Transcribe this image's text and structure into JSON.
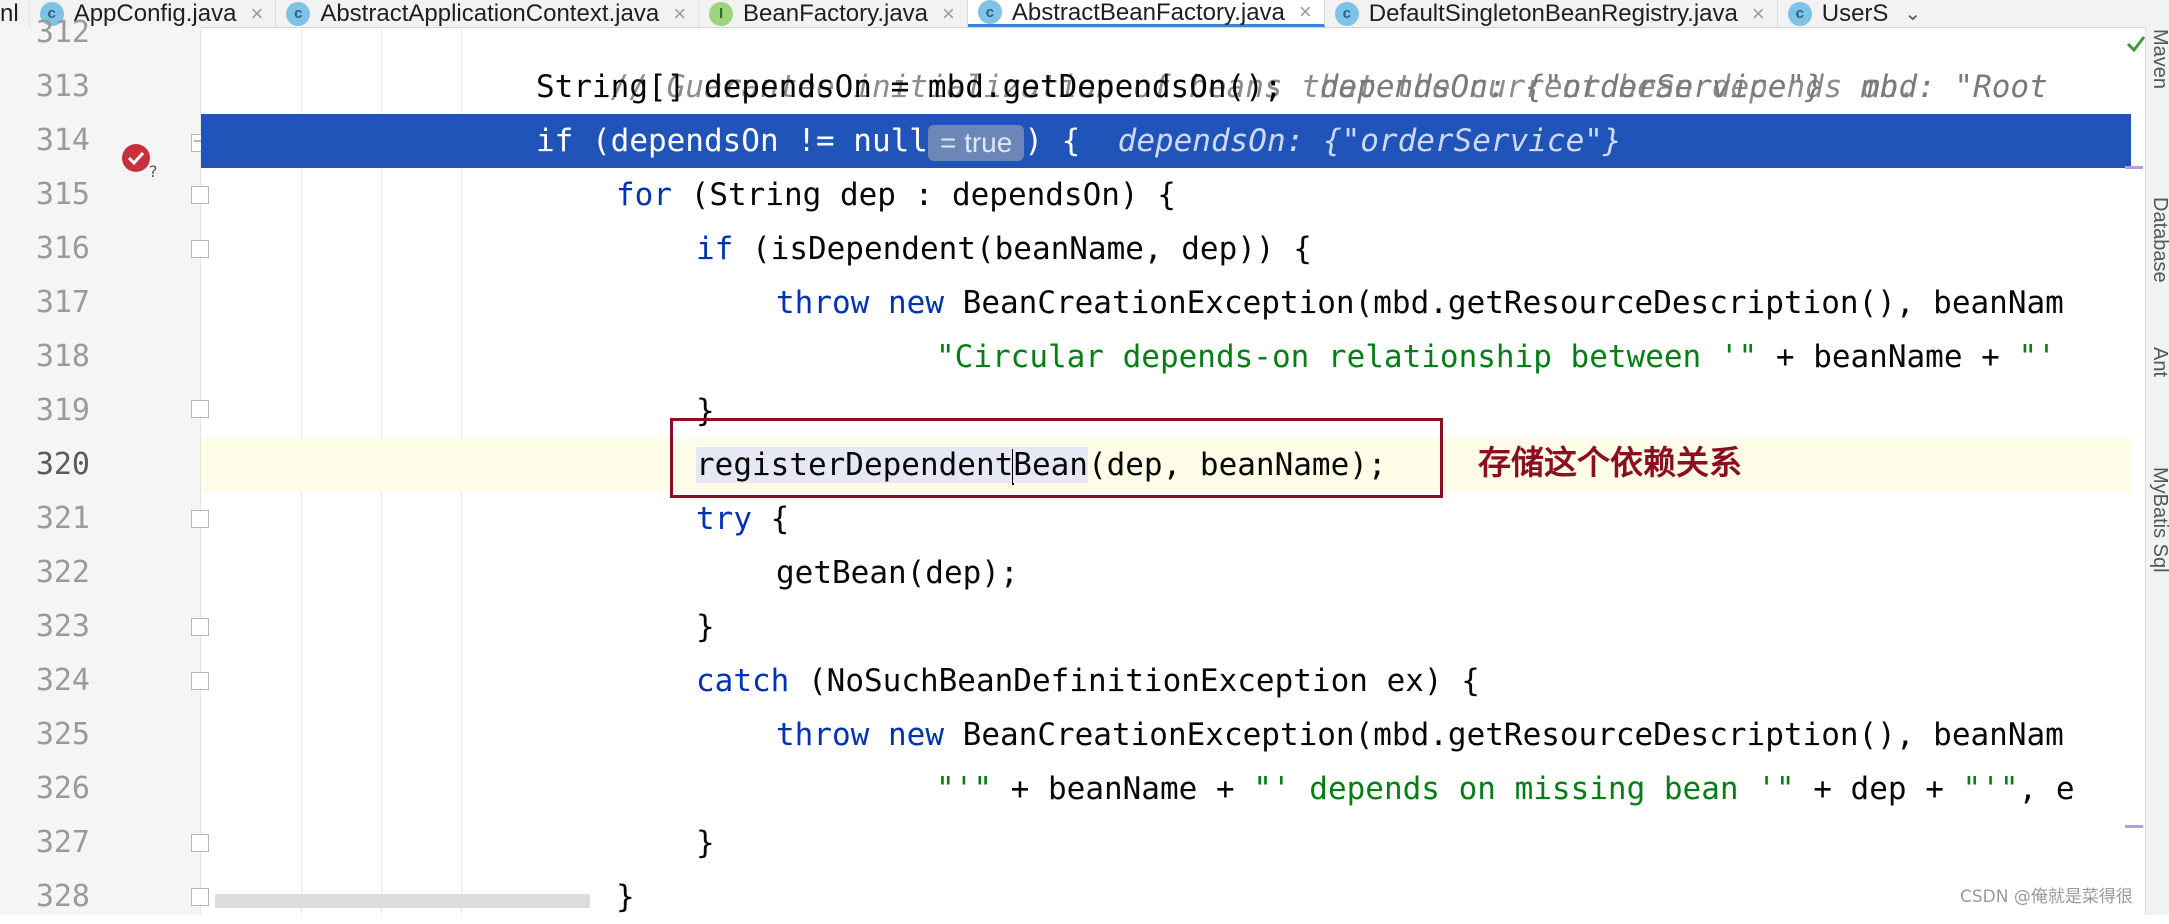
{
  "tabs": [
    {
      "label": "nl",
      "kind": "none",
      "truncated": true
    },
    {
      "label": "AppConfig.java",
      "kind": "class"
    },
    {
      "label": "AbstractApplicationContext.java",
      "kind": "class"
    },
    {
      "label": "BeanFactory.java",
      "kind": "interface"
    },
    {
      "label": "AbstractBeanFactory.java",
      "kind": "class",
      "active": true
    },
    {
      "label": "DefaultSingletonBeanRegistry.java",
      "kind": "class"
    },
    {
      "label": "UserS",
      "kind": "class",
      "truncated": true
    }
  ],
  "tab_close_glyph": "×",
  "gutter": {
    "line_numbers": [
      "312",
      "313",
      "314",
      "315",
      "316",
      "317",
      "318",
      "319",
      "320",
      "321",
      "322",
      "323",
      "324",
      "325",
      "326",
      "327",
      "328"
    ]
  },
  "code_lines": {
    "l312": "// Guarantee initialization of beans that the current bean depends on.",
    "l313_code": "String[] dependsOn = mbd.getDependsOn();",
    "l313_hint": "dependsOn: {\"orderService\"}  mbd: \"Root",
    "l314_kw": "if",
    "l314_code": " (dependsOn != null",
    "l314_inline": "= true",
    "l314_end": ") {",
    "l314_hint": "dependsOn: {\"orderService\"}",
    "l315_kw": "for",
    "l315_code": " (String dep : dependsOn) {",
    "l316_kw": "if",
    "l316_code": " (isDependent(beanName, dep)) {",
    "l317_kw1": "throw",
    "l317_kw2": "new",
    "l317_code": " BeanCreationException(mbd.getResourceDescription(), beanNam",
    "l318_str": "\"Circular depends-on relationship between '\"",
    "l318_code": " + beanName + ",
    "l318_str2": "\"'",
    "l319": "}",
    "l320_a": "registerDependent",
    "l320_b": "Bean",
    "l320_c": "(dep, beanName);",
    "l321_kw": "try",
    "l321_code": " {",
    "l322": "getBean(dep);",
    "l323": "}",
    "l324_kw": "catch",
    "l324_code": " (NoSuchBeanDefinitionException ex) {",
    "l325_kw1": "throw",
    "l325_kw2": "new",
    "l325_code": " BeanCreationException(mbd.getResourceDescription(), beanNam",
    "l326_str1": "\"'\"",
    "l326_code1": " + beanName + ",
    "l326_str2": "\"' depends on missing bean '\"",
    "l326_code2": " + dep + ",
    "l326_str3": "\"'\"",
    "l326_code3": ", e",
    "l327": "}",
    "l328": "}"
  },
  "annotation": "存储这个依赖关系",
  "right_tools": [
    "Maven",
    "Database",
    "Ant",
    "MyBatis Sql"
  ],
  "watermark": "CSDN @俺就是菜得很",
  "colors": {
    "keyword": "#0033b3",
    "string": "#067d17",
    "execution_line": "#2154b8",
    "annotation": "#8b0f22"
  }
}
